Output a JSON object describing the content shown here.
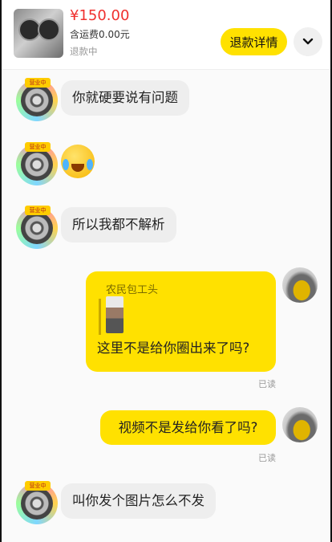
{
  "order": {
    "price": "¥150.00",
    "shipping": "含运费0.00元",
    "status": "退款中",
    "detail_button": "退款详情"
  },
  "messages": [
    {
      "side": "left",
      "type": "text",
      "text": "你就硬要说有问题"
    },
    {
      "side": "left",
      "type": "emoji",
      "emoji": "crying-laughing-face"
    },
    {
      "side": "left",
      "type": "text",
      "text": "所以我都不解析"
    },
    {
      "side": "right",
      "type": "quote",
      "quote_author": "农民包工头",
      "text": "这里不是给你圈出来了吗?",
      "read": "已读"
    },
    {
      "side": "right",
      "type": "text",
      "text": "视频不是发给你看了吗?",
      "read": "已读"
    },
    {
      "side": "left",
      "type": "text",
      "text": "叫你发个图片怎么不发"
    }
  ],
  "avatar": {
    "badge": "营业中"
  },
  "colors": {
    "accent": "#ffe100",
    "price": "#f0302e",
    "bubble_left": "#eeeeee"
  }
}
